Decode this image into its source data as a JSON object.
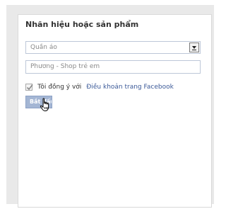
{
  "widget": {
    "title": "Nhãn hiệu hoặc sản phẩm",
    "category_select": {
      "selected": "Quần áo"
    },
    "name_input": {
      "value": "Phương - Shop trẻ em"
    },
    "agree": {
      "checked": true,
      "text": "Tôi đồng ý với",
      "link": "Điều khoản trang Facebook"
    },
    "start_button": {
      "label": "Bắt đầu"
    }
  }
}
